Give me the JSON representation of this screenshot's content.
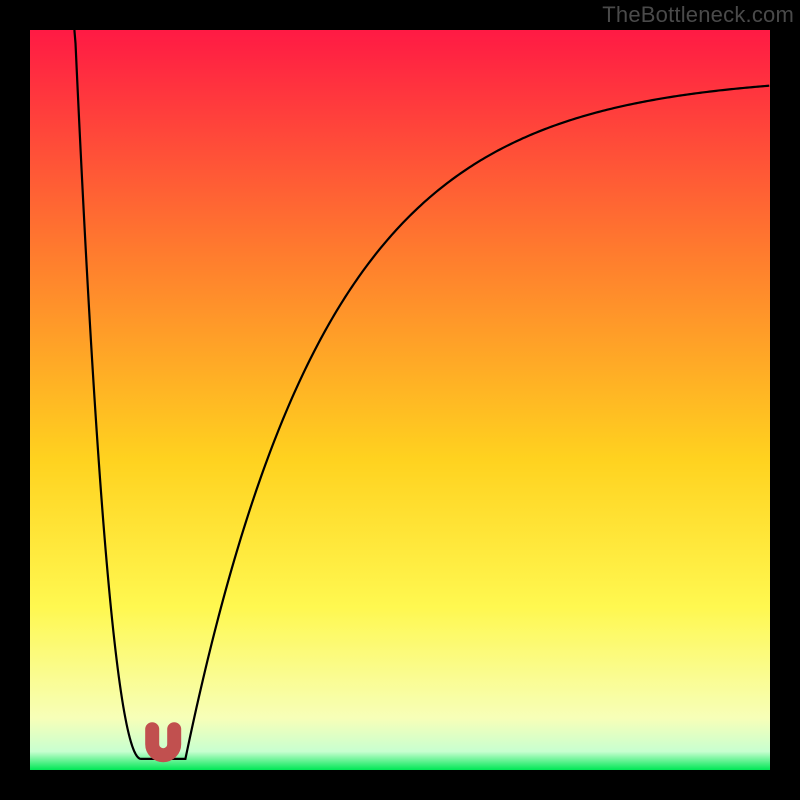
{
  "watermark": "TheBottleneck.com",
  "colors": {
    "frame": "#000000",
    "gradient_top": "#ff1a44",
    "gradient_upper_mid": "#ff7b2e",
    "gradient_mid": "#ffd21f",
    "gradient_lower_mid": "#fff850",
    "gradient_near_bottom": "#f7ffb8",
    "gradient_bottom": "#00e756",
    "curve": "#000000",
    "marker": "#c1504f"
  },
  "chart_data": {
    "type": "line",
    "title": "",
    "xlabel": "",
    "ylabel": "",
    "xlim": [
      0,
      100
    ],
    "ylim": [
      0,
      100
    ],
    "series": [
      {
        "name": "bottleneck-curve",
        "x_notch": 18,
        "left_top_x": 6,
        "right_end_y": 88,
        "notch_floor_y": 1.5,
        "notch_half_width": 3
      }
    ],
    "marker": {
      "shape": "u",
      "x": 18,
      "y": 2,
      "color": "#c1504f"
    },
    "gradient_stops": [
      {
        "pct": 0,
        "color": "#ff1a44"
      },
      {
        "pct": 30,
        "color": "#ff7b2e"
      },
      {
        "pct": 58,
        "color": "#ffd21f"
      },
      {
        "pct": 78,
        "color": "#fff850"
      },
      {
        "pct": 93,
        "color": "#f7ffb8"
      },
      {
        "pct": 97.5,
        "color": "#c8ffd0"
      },
      {
        "pct": 100,
        "color": "#00e756"
      }
    ]
  }
}
